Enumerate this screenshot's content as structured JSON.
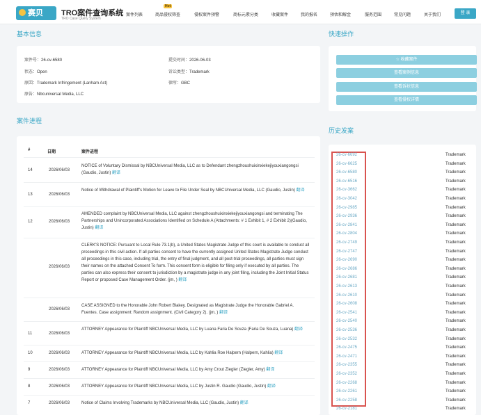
{
  "nav": {
    "logo_text": "赛贝",
    "brand_title": "TRO案件查询系统",
    "brand_subtitle": "TRO Case Query System",
    "hot_badge": "Hot",
    "items": [
      "案件列表",
      "商品侵权筛查",
      "侵权案件预警",
      "商标元素分类",
      "收藏案件",
      "我的报名",
      "预估和解金",
      "服务范围",
      "常见问题",
      "关于我们"
    ],
    "login_label": "登 录"
  },
  "basic_info": {
    "title": "基本信息",
    "case_no_label": "案件号：",
    "case_no": "26-cv-6580",
    "filed_label": "提交时间：",
    "filed": "2026-06-03",
    "status_label": "状态：",
    "status": "Open",
    "type_label": "诉讼类型：",
    "type": "Trademark",
    "cause_label": "原因：",
    "cause": "Trademark Infringement (Lanham Act)",
    "firm_label": "律所：",
    "firm": "GBC",
    "plaintiff_label": "原告：",
    "plaintiff": "Nbcuniversal Media, LLC"
  },
  "quick_actions": {
    "title": "快速操作",
    "buttons": [
      "收藏案件",
      "查看案例信息",
      "查看诉状信息",
      "查看侵权详情"
    ]
  },
  "progress": {
    "title": "案件进程",
    "headers": [
      "#",
      "日期",
      "案件进程"
    ],
    "translate_label": "翻译",
    "rows": [
      {
        "num": "14",
        "date": "2026/06/03",
        "text": "NOTICE of Voluntary Dismissal by NBCUniversal Media, LLC as to Defendant zhengzhoushuixinxiekejiyouxiangongsi (Gaudio, Justin)"
      },
      {
        "num": "13",
        "date": "2026/06/03",
        "text": "Notice of Withdrawal of Plaintiff's Motion for Leave to File Under Seal by NBCUniversal Media, LLC (Gaudio, Justin)"
      },
      {
        "num": "12",
        "date": "2026/06/03",
        "text": "AMENDED complaint by NBCUniversal Media, LLC against zhengzhoushuixinxiekejiyouxiangongsi and terminating The Partnerships and Unincorporated Associations Identified on Schedule A (Attachments: # 1 Exhibit 1, # 2 Exhibit 2)(Gaudio, Justin)"
      },
      {
        "num": "",
        "date": "2026/06/03",
        "text": "CLERK'S NOTICE: Pursuant to Local Rule 73.1(b), a United States Magistrate Judge of this court is available to conduct all proceedings in this civil action. If all parties consent to have the currently assigned United States Magistrate Judge conduct all proceedings in this case, including trial, the entry of final judgment, and all post-trial proceedings, all parties must sign their names on the attached Consent To form. This consent form is eligible for filing only if executed by all parties. The parties can also express their consent to jurisdiction by a magistrate judge in any joint filing, including the Joint Initial Status Report or proposed Case Management Order. (jm, )"
      },
      {
        "num": "",
        "date": "2026/06/03",
        "text": "CASE ASSIGNED to the Honorable John Robert Blakey. Designated as Magistrate Judge the Honorable Gabriel A. Fuentes. Case assignment: Random assignment. (Civil Category 2). (jm, )"
      },
      {
        "num": "11",
        "date": "2026/06/03",
        "text": "ATTORNEY Appearance for Plaintiff NBCUniversal Media, LLC by Luana Faria De Souza (Faria De Souza, Luana)"
      },
      {
        "num": "10",
        "date": "2026/06/03",
        "text": "ATTORNEY Appearance for Plaintiff NBCUniversal Media, LLC by Kahlia Roe Halpern (Halpern, Kahlia)"
      },
      {
        "num": "9",
        "date": "2026/06/03",
        "text": "ATTORNEY Appearance for Plaintiff NBCUniversal Media, LLC by Amy Crout Ziegler (Ziegler, Amy)"
      },
      {
        "num": "8",
        "date": "2026/06/03",
        "text": "ATTORNEY Appearance for Plaintiff NBCUniversal Media, LLC by Justin R. Gaudio (Gaudio, Justin)"
      },
      {
        "num": "7",
        "date": "2026/06/03",
        "text": "Notice of Claims Involving Trademarks by NBCUniversal Media, LLC (Gaudio, Justin)"
      }
    ]
  },
  "history": {
    "title": "历史发案",
    "items": [
      {
        "case": "26-cv-6692",
        "type": "Trademark"
      },
      {
        "case": "26-cv-6625",
        "type": "Trademark"
      },
      {
        "case": "26-cv-6580",
        "type": "Trademark"
      },
      {
        "case": "26-cv-6516",
        "type": "Trademark"
      },
      {
        "case": "26-cv-3662",
        "type": "Trademark"
      },
      {
        "case": "26-cv-3042",
        "type": "Trademark"
      },
      {
        "case": "26-cv-2985",
        "type": "Trademark"
      },
      {
        "case": "26-cv-2936",
        "type": "Trademark"
      },
      {
        "case": "26-cv-2841",
        "type": "Trademark"
      },
      {
        "case": "26-cv-2804",
        "type": "Trademark"
      },
      {
        "case": "26-cv-2749",
        "type": "Trademark"
      },
      {
        "case": "26-cv-2747",
        "type": "Trademark"
      },
      {
        "case": "26-cv-2690",
        "type": "Trademark"
      },
      {
        "case": "26-cv-2686",
        "type": "Trademark"
      },
      {
        "case": "26-cv-2681",
        "type": "Trademark"
      },
      {
        "case": "26-cv-2613",
        "type": "Trademark"
      },
      {
        "case": "26-cv-2610",
        "type": "Trademark"
      },
      {
        "case": "26-cv-2608",
        "type": "Trademark"
      },
      {
        "case": "26-cv-2541",
        "type": "Trademark"
      },
      {
        "case": "26-cv-2540",
        "type": "Trademark"
      },
      {
        "case": "26-cv-2536",
        "type": "Trademark"
      },
      {
        "case": "26-cv-2532",
        "type": "Trademark"
      },
      {
        "case": "26-cv-2475",
        "type": "Trademark"
      },
      {
        "case": "26-cv-2471",
        "type": "Trademark"
      },
      {
        "case": "26-cv-2355",
        "type": "Trademark"
      },
      {
        "case": "26-cv-2352",
        "type": "Trademark"
      },
      {
        "case": "26-cv-2268",
        "type": "Trademark"
      },
      {
        "case": "26-cv-2261",
        "type": "Trademark"
      },
      {
        "case": "26-cv-2258",
        "type": "Trademark"
      },
      {
        "case": "26-cv-2181",
        "type": "Trademark"
      }
    ]
  },
  "colors": {
    "accent": "#3aa7c6",
    "button_light": "#8ccfe0",
    "highlight_border": "#d9534f"
  }
}
